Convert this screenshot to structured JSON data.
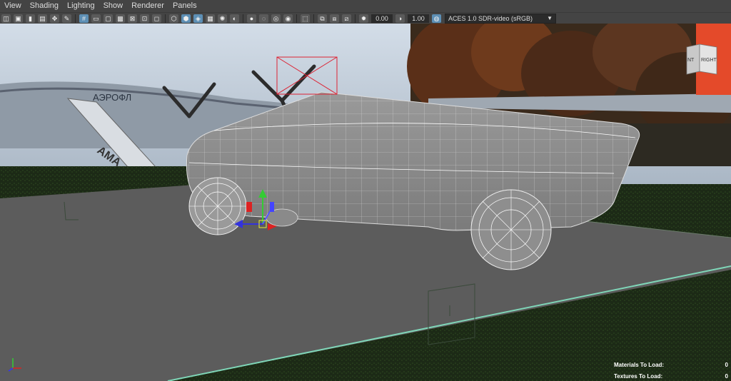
{
  "menubar": {
    "items": [
      "View",
      "Shading",
      "Lighting",
      "Show",
      "Renderer",
      "Panels"
    ]
  },
  "toolbar": {
    "exposure_value": "0.00",
    "gamma_value": "1.00",
    "colorspace_label": "ACES 1.0 SDR-video (sRGB)"
  },
  "viewcube": {
    "face_left": "NT",
    "face_right": "RIGHT"
  },
  "hud": {
    "materials_label": "Materials To Load:",
    "materials_value": "0",
    "textures_label": "Textures To Load:",
    "textures_value": "0"
  },
  "background": {
    "plane_text_1": "АЭРОФЛ",
    "plane_text_2": "АМА"
  },
  "colors": {
    "toolbar_active": "#5d8fb5",
    "mesh_gray": "#8a8a8a",
    "wireframe": "#ffffff",
    "ground_plane": "#555555",
    "ground_edge": "#7fd6b8"
  }
}
